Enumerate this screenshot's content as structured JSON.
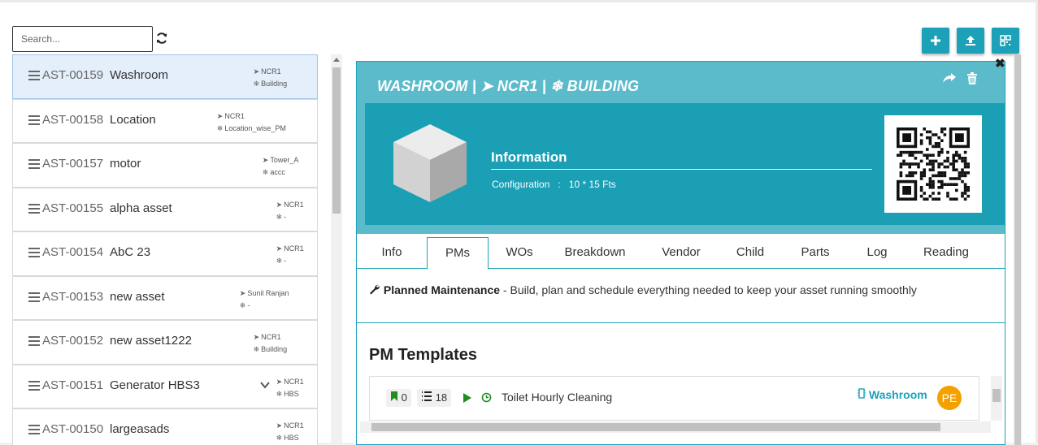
{
  "search": {
    "placeholder": "Search..."
  },
  "assets": [
    {
      "code": "AST-00159",
      "name": "Washroom",
      "location": "NCR1",
      "category": "Building",
      "active": true
    },
    {
      "code": "AST-00158",
      "name": "Location",
      "location": "NCR1",
      "category": "Location_wise_PM"
    },
    {
      "code": "AST-00157",
      "name": "motor",
      "location": "Tower_A",
      "category": "accc"
    },
    {
      "code": "AST-00155",
      "name": "alpha asset",
      "location": "NCR1",
      "category": "-"
    },
    {
      "code": "AST-00154",
      "name": "AbC 23",
      "location": "NCR1",
      "category": "-"
    },
    {
      "code": "AST-00153",
      "name": "new asset",
      "location": "Sunil Ranjan",
      "category": "-"
    },
    {
      "code": "AST-00152",
      "name": "new asset1222",
      "location": "NCR1",
      "category": "Building"
    },
    {
      "code": "AST-00151",
      "name": "Generator HBS3",
      "location": "NCR1",
      "category": "HBS"
    },
    {
      "code": "AST-00150",
      "name": "largeasads",
      "location": "NCR1",
      "category": "HBS"
    }
  ],
  "toolbar": {
    "add": "+",
    "upload": "upload-icon",
    "qr": "qr-icon"
  },
  "detail": {
    "title": "WASHROOM | ➤ NCR1 | ❄ BUILDING",
    "info_title": "Information",
    "config_label": "Configuration",
    "config_sep": ":",
    "config_value": "10 * 15 Fts",
    "close": "✖"
  },
  "tabs": [
    "Info",
    "PMs",
    "WOs",
    "Breakdown",
    "Vendor",
    "Child",
    "Parts",
    "Log",
    "Reading"
  ],
  "active_tab": "PMs",
  "pm": {
    "desc_title": "Planned Maintenance",
    "desc_text": " - Build, plan and schedule everything needed to keep your asset running smoothly",
    "heading": "PM Templates",
    "templates": [
      {
        "flag_count": "0",
        "list_count": "18",
        "name": "Toilet Hourly Cleaning",
        "location": "Washroom",
        "assignee": "PE"
      }
    ]
  },
  "colors": {
    "accent": "#1da1b8",
    "header": "#5bbbca",
    "active_item": "#e4effb",
    "avatar": "#f4a100",
    "play": "#1e8e1e"
  }
}
